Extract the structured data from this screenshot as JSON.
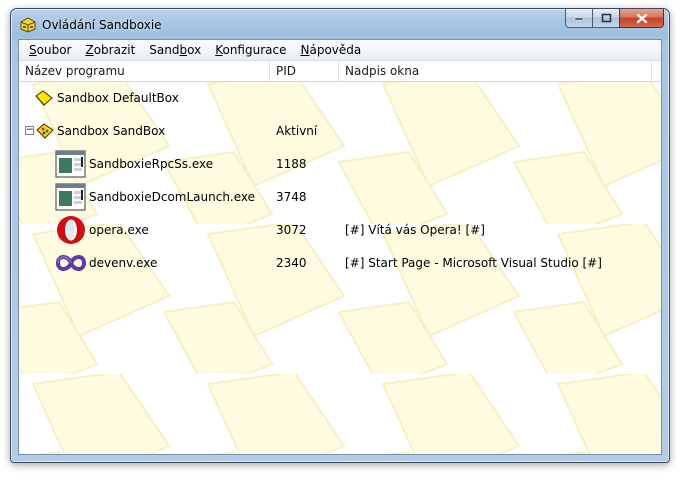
{
  "window": {
    "title": "Ovládání Sandboxie"
  },
  "menu": [
    {
      "label": "Soubor",
      "underline": "S",
      "rest": "oubor"
    },
    {
      "label": "Zobrazit",
      "underline": "Z",
      "rest": "obrazit"
    },
    {
      "label": "Sandbox",
      "pre": "Sand",
      "underline": "b",
      "rest": "ox"
    },
    {
      "label": "Konfigurace",
      "underline": "K",
      "rest": "onfigurace"
    },
    {
      "label": "Nápověda",
      "underline": "N",
      "rest": "ápověda"
    }
  ],
  "columns": {
    "name": "Název programu",
    "pid": "PID",
    "title": "Nadpis okna"
  },
  "rows": [
    {
      "name": "Sandbox DefaultBox",
      "pid": "",
      "title": "",
      "icon": "sandbox-icon"
    },
    {
      "name": "Sandbox SandBox",
      "pid": "Aktivní",
      "title": "",
      "icon": "sandbox-active-icon",
      "expander": "−"
    },
    {
      "name": "SandboxieRpcSs.exe",
      "pid": "1188",
      "title": "",
      "icon": "window-app-icon"
    },
    {
      "name": "SandboxieDcomLaunch.exe",
      "pid": "3748",
      "title": "",
      "icon": "window-app-icon"
    },
    {
      "name": "opera.exe",
      "pid": "3072",
      "title": "[#] Vítá vás Opera! [#]",
      "icon": "opera-icon"
    },
    {
      "name": "devenv.exe",
      "pid": "2340",
      "title": "[#] Start Page - Microsoft Visual Studio [#]",
      "icon": "visual-studio-icon"
    }
  ],
  "colors": {
    "pattern": "#fefbe0",
    "sandbox_yellow": "#ffe600",
    "opera_red": "#cc0f16",
    "vs_purple": "#5c3aa8"
  }
}
